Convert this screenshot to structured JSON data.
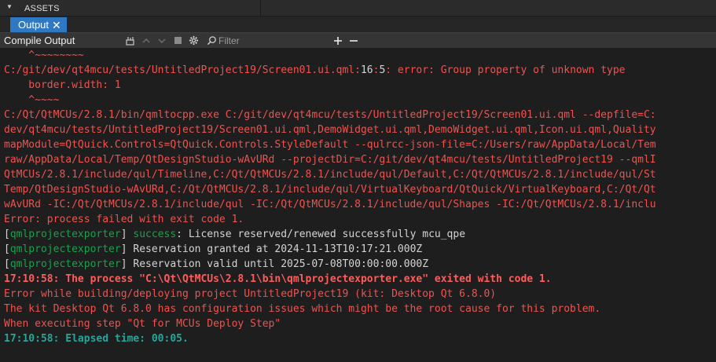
{
  "assets_bar": {
    "label": "ASSETS",
    "arrow": "▼"
  },
  "tabs": [
    {
      "label": "Output",
      "close_glyph": "✕"
    }
  ],
  "panel": {
    "title": "Compile Output",
    "filter_placeholder": "Filter",
    "icons": [
      "clear-icon",
      "arrow-up-icon",
      "arrow-down-icon",
      "stop-icon",
      "gear-icon",
      "search-icon",
      "plus-icon",
      "minus-icon"
    ]
  },
  "colors": {
    "tab_active": "#2f78c4",
    "error_red": "#ef5350",
    "success_green": "#16a34a",
    "elapsed_teal": "#26a69a"
  },
  "output_lines": {
    "l1": "    ^~~~~~~~~",
    "l2_path": "C:/git/dev/qt4mcu/tests/UntitledProject19/Screen01.ui.qml",
    "l2_line": "16",
    "l2_col": "5",
    "l2_msg": ": error: Group property of unknown type",
    "l3": "    border.width: 1",
    "l4": "    ^~~~~",
    "l5": "C:/Qt/QtMCUs/2.8.1/bin/qmltocpp.exe C:/git/dev/qt4mcu/tests/UntitledProject19/Screen01.ui.qml --depfile=C:",
    "l6": "dev/qt4mcu/tests/UntitledProject19/Screen01.ui.qml,DemoWidget.ui.qml,DemoWidget.ui.qml,Icon.ui.qml,Quality",
    "l7": "mapModule=QtQuick.Controls=QtQuick.Controls.StyleDefault --qulrcc-json-file=C:/Users/raw/AppData/Local/Tem",
    "l8": "raw/AppData/Local/Temp/QtDesignStudio-wAvURd --projectDir=C:/git/dev/qt4mcu/tests/UntitledProject19 --qmlI",
    "l9": "QtMCUs/2.8.1/include/qul/Timeline,C:/Qt/QtMCUs/2.8.1/include/qul/Default,C:/Qt/QtMCUs/2.8.1/include/qul/St",
    "l10": "Temp/QtDesignStudio-wAvURd,C:/Qt/QtMCUs/2.8.1/include/qul/VirtualKeyboard/QtQuick/VirtualKeyboard,C:/Qt/Qt",
    "l11": "wAvURd -IC:/Qt/QtMCUs/2.8.1/include/qul -IC:/Qt/QtMCUs/2.8.1/include/qul/Shapes -IC:/Qt/QtMCUs/2.8.1/inclu",
    "l12": "Error: process failed with exit code 1.",
    "l13_tag": "qmlprojectexporter",
    "l13_status": "success",
    "l13_msg": ": License reserved/renewed successfully mcu_qpe",
    "l14_tag": "qmlprojectexporter",
    "l14_msg": " Reservation granted at 2024-11-13T10:17:21.000Z",
    "l15_tag": "qmlprojectexporter",
    "l15_msg": " Reservation valid until 2025-07-08T00:00:00.000Z",
    "l16": "17:10:58: The process \"C:\\Qt\\QtMCUs\\2.8.1\\bin\\qmlprojectexporter.exe\" exited with code 1.",
    "l17": "Error while building/deploying project UntitledProject19 (kit: Desktop Qt 6.8.0)",
    "l18": "The kit Desktop Qt 6.8.0 has configuration issues which might be the root cause for this problem.",
    "l19": "When executing step \"Qt for MCUs Deploy Step\"",
    "l20": "17:10:58: Elapsed time: 00:05."
  }
}
